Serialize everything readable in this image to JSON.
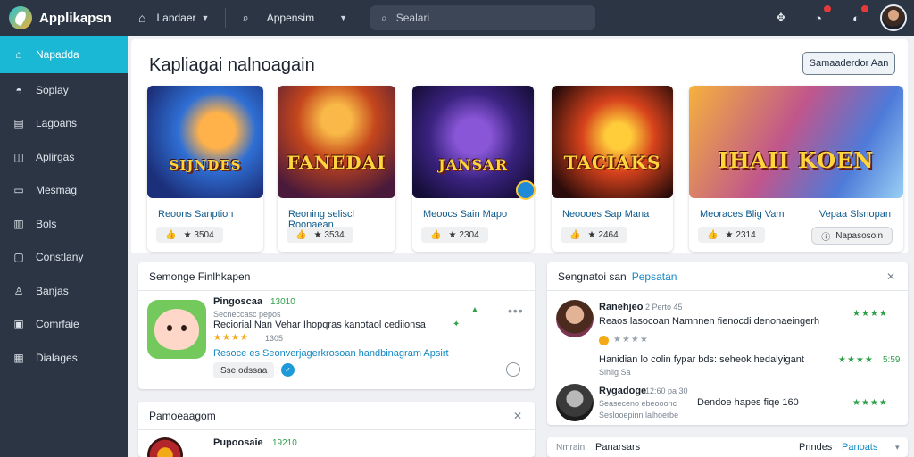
{
  "app": {
    "name": "Applikapsn"
  },
  "topbar": {
    "home_label": "Landaer",
    "app_selector": "Appensim",
    "search_placeholder": "Sealari"
  },
  "sidebar": {
    "items": [
      {
        "label": "Napadda",
        "icon": "home-icon",
        "active": true
      },
      {
        "label": "Soplay",
        "icon": "bell-icon"
      },
      {
        "label": "Lagoans",
        "icon": "book-icon"
      },
      {
        "label": "Aplirgas",
        "icon": "apps-icon"
      },
      {
        "label": "Mesmag",
        "icon": "mail-icon"
      },
      {
        "label": "Bols",
        "icon": "chart-icon"
      },
      {
        "label": "Constlany",
        "icon": "chat-icon"
      },
      {
        "label": "Banjas",
        "icon": "user-icon"
      },
      {
        "label": "Comrfaie",
        "icon": "calendar-icon"
      },
      {
        "label": "Dialages",
        "icon": "folder-icon"
      }
    ]
  },
  "featured": {
    "title": "Kapliagai nalnoagain",
    "action_label": "Samaaderdor Aan",
    "cards": [
      {
        "art_text": "SIJNDES",
        "title": "Reoons Sanption",
        "stat": "3504",
        "palette": "card-1"
      },
      {
        "art_text": "FANEDAI",
        "title": "Reoning seliscl Roonaean",
        "stat": "3534",
        "palette": "card-2"
      },
      {
        "art_text": "JANSAR",
        "title": "Meoocs Sain Mapo",
        "stat": "2304",
        "palette": "card-3"
      },
      {
        "art_text": "TACIAKS",
        "title": "Neoooes Sap Mana",
        "stat": "2464",
        "palette": "card-4"
      },
      {
        "art_text": "IHAII KOEN",
        "title": "Meoraces Blig Vam",
        "title2": "Vepaa Slsnopan",
        "stat": "2314",
        "chip_right": "Napasosoin",
        "palette": "card-5"
      }
    ]
  },
  "review_panel": {
    "title": "Semonge Finlhkapen",
    "app_name": "Pingoscaa",
    "app_score": "13010",
    "app_sub": "Secneccasc pepos",
    "review_text": "Reciorial Nan Vehar Ihopqras kanotaol cediionsa",
    "rating_count": "1305",
    "link_text": "Resoce es Seonverjagerkrosoan handbinagram Apsirt",
    "chip": "Sse odssaa"
  },
  "right_panel": {
    "title": "Sengnatoi san",
    "title_accent": "Pepsatan",
    "reviews": [
      {
        "name": "Ranehjeo",
        "meta": "2 Perto 45",
        "text": "Reaos lasocoan Namnnen fienocdi denonaeingerh",
        "extra": "Hanidian lo colin fypar bds: seheok hedalyigant",
        "extra_sub": "Sihlig Sa",
        "score": "5:59"
      },
      {
        "name": "Rygadoge",
        "meta": "12:60 pa 30",
        "sub": "Seaseceno ebeooonc",
        "text": "Dendoe hapes fiqe 160",
        "extra_sub": "Seslooepinn lalhoerbe"
      }
    ]
  },
  "bottom_left_panel": {
    "title": "Pamoeaagom",
    "app_name": "Pupoosaie",
    "app_score": "19210"
  },
  "bottom_right_panel": {
    "left_label": "Nmrain",
    "title": "Panarsars",
    "right_label": "Pnndes",
    "right_link": "Panoats"
  }
}
